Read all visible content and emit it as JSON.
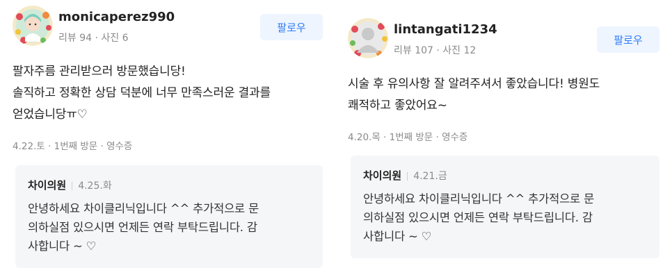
{
  "reviews": [
    {
      "user": {
        "name": "monicaperez990",
        "meta": "리뷰 94 · 사진 6",
        "avatar": "avatar-icon"
      },
      "follow_label": "팔로우",
      "review_lines": [
        "팔자주름 관리받으러 방문했습니당!",
        "솔직하고 정확한 상담 덕분에 너무 만족스러운 결과를",
        "얻었습니당ㅠ♡"
      ],
      "visit": "4.22.토 · 1번째 방문 · 영수증",
      "reply": {
        "author": "차이의원",
        "date": "4.25.화",
        "lines": [
          "안녕하세요 차이클리닉입니다 ^^ 추가적으로 문",
          "의하실점 있으시면 언제든 연락 부탁드립니다. 감",
          "사합니다 ~ ♡"
        ]
      }
    },
    {
      "user": {
        "name": "lintangati1234",
        "meta": "리뷰 107 · 사진 12",
        "avatar": "default-avatar-icon"
      },
      "follow_label": "팔로우",
      "review_lines": [
        "시술 후 유의사항 잘 알려주셔서 좋았습니다! 병원도",
        "쾌적하고 좋았어요~"
      ],
      "visit": "4.20.목 · 1번째 방문 · 영수증",
      "reply": {
        "author": "차이의원",
        "date": "4.21.금",
        "lines": [
          "안녕하세요 차이클리닉입니다 ^^ 추가적으로 문",
          "의하실점 있으시면 언제든 연락 부탁드립니다. 감",
          "사합니다 ~ ♡"
        ]
      }
    }
  ],
  "colors": {
    "accent": "#2f7bf5",
    "follow_bg": "#eef5ff",
    "reply_bg": "#f5f6f8",
    "muted": "#8a8a8a"
  }
}
